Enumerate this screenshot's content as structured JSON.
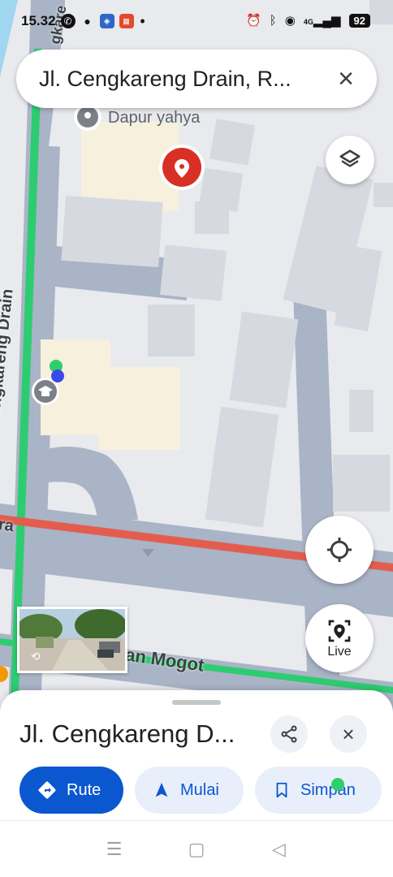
{
  "status_bar": {
    "time": "15.32",
    "network": "4G",
    "battery": "92"
  },
  "search": {
    "query": "Jl. Cengkareng Drain, R..."
  },
  "map": {
    "labels": {
      "place": "Dapur yahya",
      "street_vertical": "Cengkareng Drain",
      "street_bottom": "an Mogot",
      "street_left": "ra",
      "street_top": "gkare"
    }
  },
  "buttons": {
    "live_label": "Live"
  },
  "sheet": {
    "title": "Jl. Cengkareng D...",
    "actions": {
      "route": "Rute",
      "start": "Mulai",
      "save": "Simpan"
    }
  },
  "colors": {
    "accent": "#0b57d0",
    "pin_red": "#d93025",
    "road_red": "#e35d4f",
    "road_green": "#2ecc71"
  },
  "icons": [
    "whatsapp-icon",
    "chat-icon",
    "app-icon",
    "app-icon-2",
    "alarm-icon",
    "bluetooth-icon",
    "location-icon",
    "signal-icon",
    "close-icon",
    "layers-icon",
    "map-pin-icon",
    "school-icon",
    "my-location-icon",
    "live-view-icon",
    "share-icon",
    "directions-icon",
    "navigation-arrow-icon",
    "bookmark-icon",
    "menu-icon",
    "home-icon",
    "back-icon"
  ]
}
